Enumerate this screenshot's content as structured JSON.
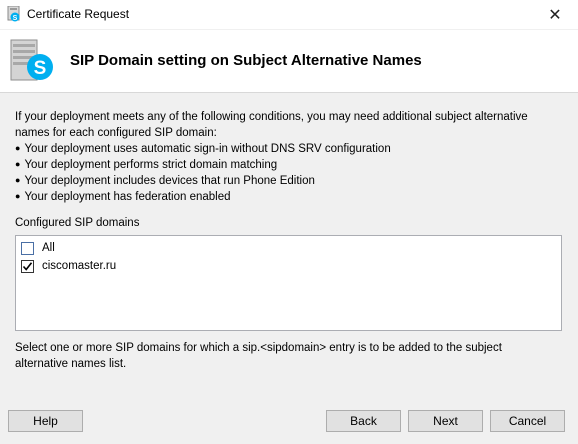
{
  "window": {
    "title": "Certificate Request",
    "close_label": "✕"
  },
  "header": {
    "title": "SIP Domain setting on Subject Alternative Names",
    "icon": "skype-server-icon"
  },
  "intro": {
    "text": "If your deployment meets any of the following conditions, you may need additional subject alternative names for each configured SIP domain:",
    "bullets": [
      "Your deployment uses automatic sign-in without DNS SRV configuration",
      "Your deployment performs strict domain matching",
      "Your deployment includes devices that run Phone Edition",
      "Your deployment has federation enabled"
    ]
  },
  "domains": {
    "label": "Configured SIP domains",
    "items": [
      {
        "label": "All",
        "checked": false
      },
      {
        "label": "ciscomaster.ru",
        "checked": true
      }
    ]
  },
  "note": "Select one or more SIP domains for which a sip.<sipdomain> entry is to be added to the subject alternative names list.",
  "buttons": {
    "help": "Help",
    "back": "Back",
    "next": "Next",
    "cancel": "Cancel"
  },
  "colors": {
    "skype_blue": "#00aff0",
    "background": "#f0f0f0",
    "button": "#e1e1e1"
  }
}
